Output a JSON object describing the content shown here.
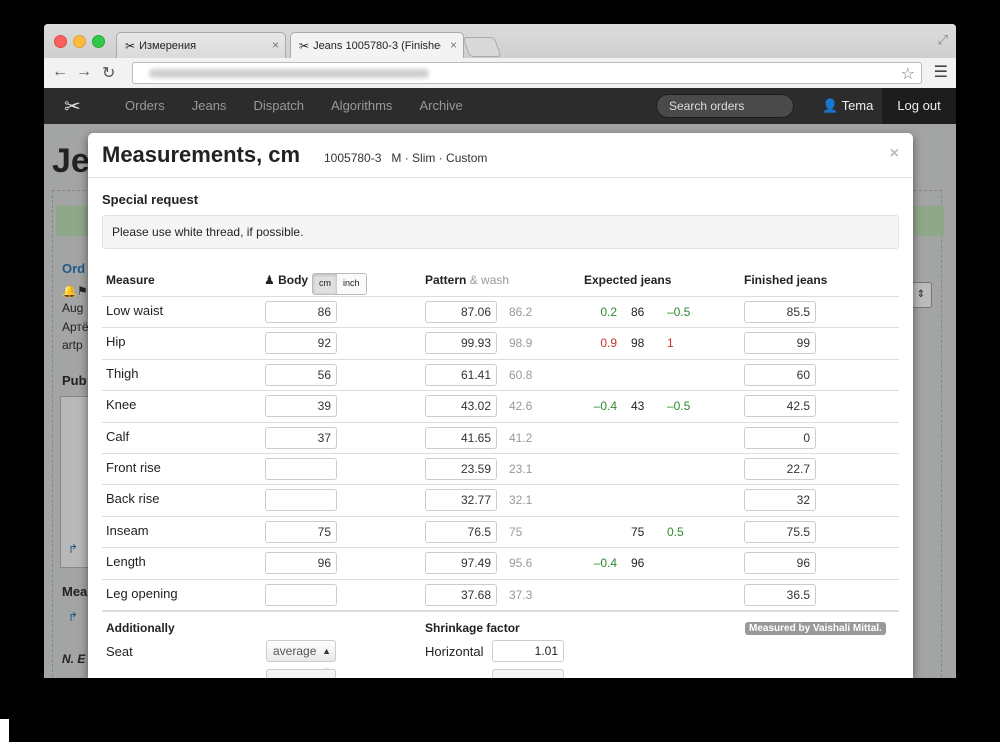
{
  "browser": {
    "tabs": [
      {
        "title": "Измерения"
      },
      {
        "title": "Jeans 1005780-3 (Finishec"
      }
    ]
  },
  "navbar": {
    "links": [
      "Orders",
      "Jeans",
      "Dispatch",
      "Algorithms",
      "Archive"
    ],
    "search_placeholder": "Search orders",
    "user": "Tema",
    "logout": "Log out"
  },
  "background": {
    "title": "Je",
    "texts": [
      "Ord",
      "Aug",
      "Артё",
      "artp",
      "Pub",
      "Mea",
      "N. E"
    ]
  },
  "modal": {
    "title": "Measurements, cm",
    "subtitle": "1005780-3   M · Slim · Custom",
    "special_request_label": "Special request",
    "special_request_text": "Please use white thread, if possible.",
    "headers": {
      "measure": "Measure",
      "body": "Body",
      "unit_cm": "cm",
      "unit_inch": "inch",
      "pattern": "Pattern",
      "wash": "& wash",
      "expected": "Expected jeans",
      "finished": "Finished jeans"
    },
    "rows": [
      {
        "measure": "Low waist",
        "body": "86",
        "pattern": "87.06",
        "wash": "86.2",
        "exp_a": "0.2",
        "exp_a_color": "green",
        "exp_b": "86",
        "exp_c": "–0.5",
        "exp_c_color": "green",
        "finished": "85.5"
      },
      {
        "measure": "Hip",
        "body": "92",
        "pattern": "99.93",
        "wash": "98.9",
        "exp_a": "0.9",
        "exp_a_color": "red",
        "exp_b": "98",
        "exp_c": "1",
        "exp_c_color": "red",
        "finished": "99"
      },
      {
        "measure": "Thigh",
        "body": "56",
        "pattern": "61.41",
        "wash": "60.8",
        "exp_a": "",
        "exp_a_color": "green",
        "exp_b": "",
        "exp_c": "",
        "exp_c_color": "green",
        "finished": "60"
      },
      {
        "measure": "Knee",
        "body": "39",
        "pattern": "43.02",
        "wash": "42.6",
        "exp_a": "–0.4",
        "exp_a_color": "green",
        "exp_b": "43",
        "exp_c": "–0.5",
        "exp_c_color": "green",
        "finished": "42.5"
      },
      {
        "measure": "Calf",
        "body": "37",
        "pattern": "41.65",
        "wash": "41.2",
        "exp_a": "",
        "exp_a_color": "green",
        "exp_b": "",
        "exp_c": "",
        "exp_c_color": "green",
        "finished": "0"
      },
      {
        "measure": "Front rise",
        "body": "",
        "pattern": "23.59",
        "wash": "23.1",
        "exp_a": "",
        "exp_a_color": "green",
        "exp_b": "",
        "exp_c": "",
        "exp_c_color": "green",
        "finished": "22.7"
      },
      {
        "measure": "Back rise",
        "body": "",
        "pattern": "32.77",
        "wash": "32.1",
        "exp_a": "",
        "exp_a_color": "green",
        "exp_b": "",
        "exp_c": "",
        "exp_c_color": "green",
        "finished": "32"
      },
      {
        "measure": "Inseam",
        "body": "75",
        "pattern": "76.5",
        "wash": "75",
        "exp_a": "",
        "exp_a_color": "green",
        "exp_b": "75",
        "exp_c": "0.5",
        "exp_c_color": "green",
        "finished": "75.5"
      },
      {
        "measure": "Length",
        "body": "96",
        "pattern": "97.49",
        "wash": "95.6",
        "exp_a": "–0.4",
        "exp_a_color": "green",
        "exp_b": "96",
        "exp_c": "",
        "exp_c_color": "green",
        "finished": "96"
      },
      {
        "measure": "Leg opening",
        "body": "",
        "pattern": "37.68",
        "wash": "37.3",
        "exp_a": "",
        "exp_a_color": "green",
        "exp_b": "",
        "exp_c": "",
        "exp_c_color": "green",
        "finished": "36.5"
      }
    ],
    "additionally_label": "Additionally",
    "shrinkage_label": "Shrinkage factor",
    "measured_by": "Measured by Vaishali Mittal.",
    "seat_label": "Seat",
    "seat_value": "average",
    "horizontal_label": "Horizontal",
    "horizontal_value": "1.01"
  },
  "colors": {
    "accent_green": "#2e8b2e",
    "accent_red": "#c53030",
    "navbar": "#2c2c2c"
  }
}
